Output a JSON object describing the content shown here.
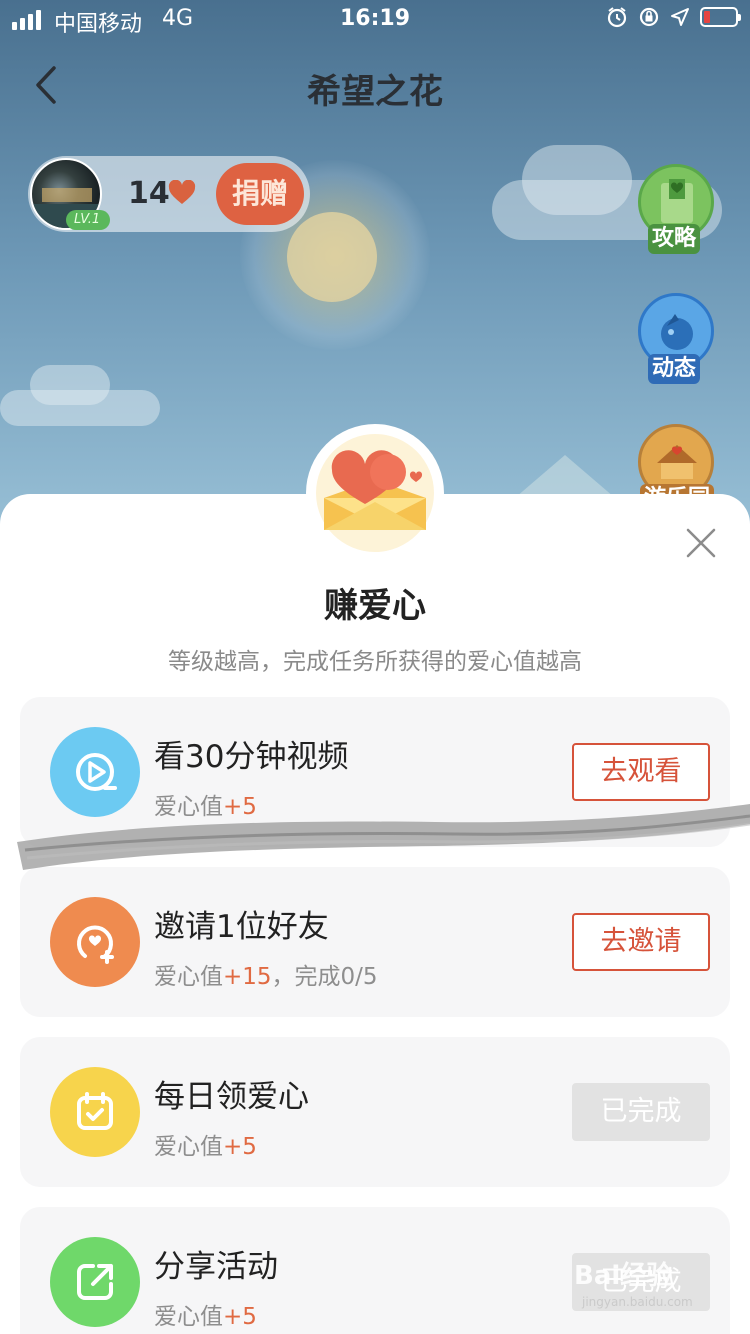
{
  "status_bar": {
    "carrier": "中国移动",
    "network": "4G",
    "time": "16:19"
  },
  "nav": {
    "title": "希望之花",
    "back_icon": "chevron-left-icon"
  },
  "user": {
    "level": "LV.1",
    "heart_count": "14",
    "donate_label": "捐赠"
  },
  "float_buttons": [
    {
      "label": "攻略",
      "icon": "guide-book-icon",
      "color": "#5aa84a"
    },
    {
      "label": "动态",
      "icon": "news-feed-icon",
      "color": "#2f78c8"
    },
    {
      "label": "游乐园",
      "icon": "carousel-icon",
      "color": "#b7803a"
    }
  ],
  "sheet": {
    "title": "赚爱心",
    "subtitle": "等级越高，完成任务所获得的爱心值越高",
    "close_icon": "close-icon",
    "badge_icon": "heart-envelope-icon"
  },
  "tasks": [
    {
      "name": "看30分钟视频",
      "reward_prefix": "爱心值",
      "reward_plus": "+5",
      "reward_extra": "",
      "button": "去观看",
      "done": false,
      "icon": "video-play-icon",
      "color": "#6ccaf2"
    },
    {
      "name": "邀请1位好友",
      "reward_prefix": "爱心值",
      "reward_plus": "+15",
      "reward_extra": "，完成0/5",
      "button": "去邀请",
      "done": false,
      "icon": "invite-friend-icon",
      "color": "#ef8b4f"
    },
    {
      "name": "每日领爱心",
      "reward_prefix": "爱心值",
      "reward_plus": "+5",
      "reward_extra": "",
      "button": "已完成",
      "done": true,
      "icon": "calendar-check-icon",
      "color": "#f7d44c"
    },
    {
      "name": "分享活动",
      "reward_prefix": "爱心值",
      "reward_plus": "+5",
      "reward_extra": "",
      "button": "已完成",
      "done": true,
      "icon": "share-icon",
      "color": "#6fd86a"
    }
  ],
  "watermark": {
    "text": "Bai经验",
    "sub": "jingyan.baidu.com"
  }
}
